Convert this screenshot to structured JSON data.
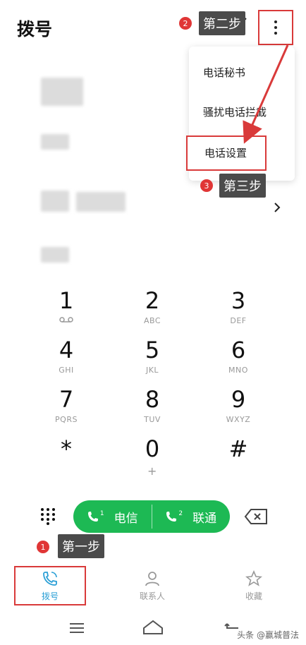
{
  "header": {
    "title": "拨号"
  },
  "menu": {
    "items": [
      "电话秘书",
      "骚扰电话拦截",
      "电话设置"
    ]
  },
  "steps": {
    "one": {
      "num": "1",
      "label": "第一步"
    },
    "two": {
      "num": "2",
      "label": "第二步"
    },
    "three": {
      "num": "3",
      "label": "第三步"
    }
  },
  "dialpad": [
    {
      "num": "1",
      "sub": ""
    },
    {
      "num": "2",
      "sub": "ABC"
    },
    {
      "num": "3",
      "sub": "DEF"
    },
    {
      "num": "4",
      "sub": "GHI"
    },
    {
      "num": "5",
      "sub": "JKL"
    },
    {
      "num": "6",
      "sub": "MNO"
    },
    {
      "num": "7",
      "sub": "PQRS"
    },
    {
      "num": "8",
      "sub": "TUV"
    },
    {
      "num": "9",
      "sub": "WXYZ"
    },
    {
      "num": "*",
      "sub": ""
    },
    {
      "num": "0",
      "sub": "+"
    },
    {
      "num": "#",
      "sub": ""
    }
  ],
  "call_buttons": {
    "sim1": {
      "index": "1",
      "label": "电信"
    },
    "sim2": {
      "index": "2",
      "label": "联通"
    }
  },
  "tabs": [
    {
      "label": "拨号"
    },
    {
      "label": "联系人"
    },
    {
      "label": "收藏"
    }
  ],
  "watermark": "头条 @赢城普法",
  "colors": {
    "accent": "#2a9fd6",
    "call_green": "#1db954",
    "annotation_red": "#d93a3a"
  }
}
